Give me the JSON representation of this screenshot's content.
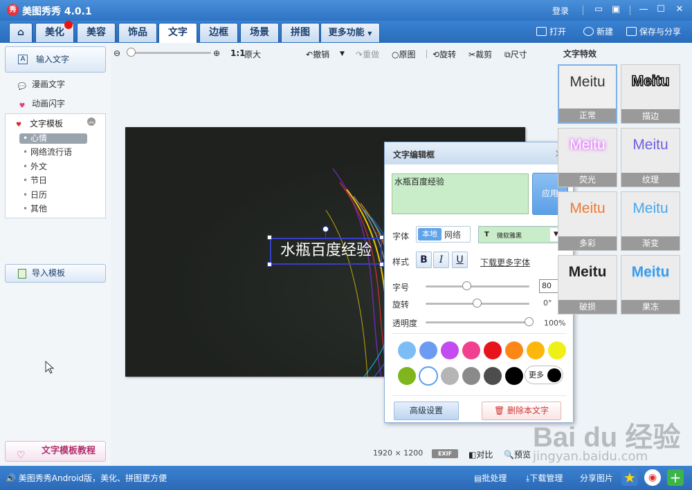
{
  "window": {
    "logo_glyph": "秀",
    "title": "美图秀秀 4.0.1",
    "login": "登录"
  },
  "tabs": {
    "home_icon": "home-icon",
    "items": [
      "美化",
      "美容",
      "饰品",
      "文字",
      "边框",
      "场景",
      "拼图",
      "更多功能"
    ],
    "active": "文字"
  },
  "top_actions": {
    "open": "打开",
    "new": "新建",
    "save_share": "保存与分享"
  },
  "sidebar": {
    "input_text": "输入文字",
    "comic_text": "漫画文字",
    "animated_text": "动画闪字",
    "template_header": "文字模板",
    "template_items": [
      "心情",
      "网络流行语",
      "外文",
      "节日",
      "日历",
      "其他"
    ],
    "template_active": "心情",
    "import_template": "导入模板",
    "tutorial": "文字模板教程"
  },
  "toolbar": {
    "zoom_ratio": "1:1",
    "original_size": "原大",
    "undo": "撤销",
    "redo": "重做",
    "original": "原图",
    "rotate": "旋转",
    "crop": "裁剪",
    "resize": "尺寸"
  },
  "canvas": {
    "text": "水瓶百度经验"
  },
  "dialog": {
    "title": "文字编辑框",
    "text_value": "水瓶百度经验",
    "apply": "应用",
    "font_label": "字体",
    "font_local": "本地",
    "font_net": "网络",
    "font_name": "微软雅黑",
    "style_label": "样式",
    "bold": "B",
    "italic": "I",
    "underline": "U",
    "more_fonts": "下载更多字体",
    "size_label": "字号",
    "size_value": "80",
    "rotate_label": "旋转",
    "rotate_value": "0°",
    "opacity_label": "透明度",
    "opacity_value": "100%",
    "size_level": 0.4,
    "rotate_level": 0.5,
    "opacity_level": 1.0,
    "colors": [
      "#7dbdf5",
      "#6c9cf2",
      "#c34bef",
      "#f0408f",
      "#e8141c",
      "#fb8717",
      "#fdb70c",
      "#eef016",
      "#7fb61d",
      "#ffffff",
      "#b5b5b5",
      "#8a8a8a",
      "#4d4d4d",
      "#000000"
    ],
    "selected_color": "#ffffff",
    "more_colors": "更多",
    "more_color_swatch": "#000000",
    "advanced": "高级设置",
    "delete": "删除本文字"
  },
  "effects": {
    "title": "文字特效",
    "sample": "Meitu",
    "items": [
      {
        "label": "正常",
        "color": "#333333"
      },
      {
        "label": "描边",
        "color": "#000000"
      },
      {
        "label": "荧光",
        "color": "#ffffff"
      },
      {
        "label": "纹理",
        "color": "#6d5fe0"
      },
      {
        "label": "多彩",
        "color": "#f07830"
      },
      {
        "label": "渐变",
        "color": "#4aa6ec"
      },
      {
        "label": "破损",
        "color": "#222222"
      },
      {
        "label": "果冻",
        "color": "#3e9ce8"
      }
    ],
    "active": "正常"
  },
  "bottom_bar": {
    "image_size": "1920 × 1200",
    "exif": "EXIF",
    "compare": "对比",
    "preview": "预览"
  },
  "statusbar": {
    "message": "美图秀秀Android版，美化、拼图更方便",
    "batch": "批处理",
    "download": "下载管理",
    "share": "分享图片"
  },
  "watermark": {
    "logo": "Bai du 经验",
    "url": "jingyan.baidu.com"
  }
}
